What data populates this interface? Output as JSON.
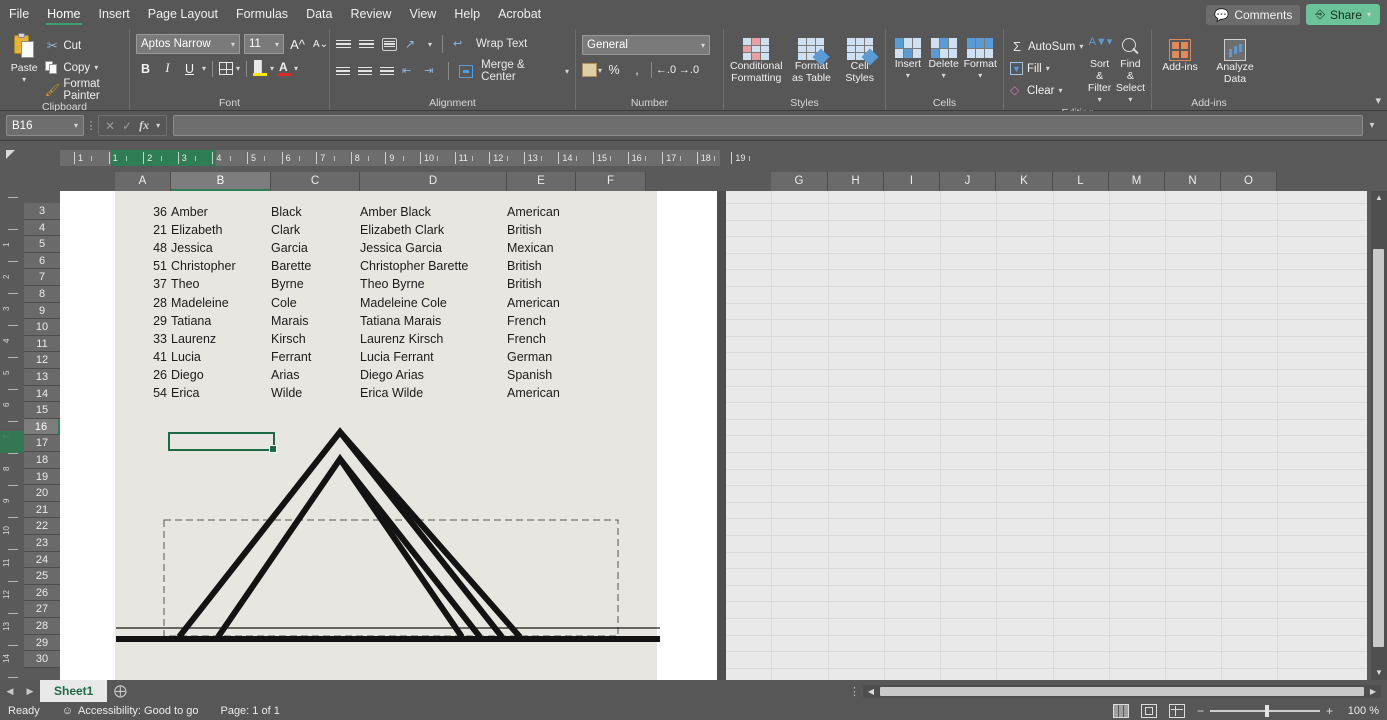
{
  "app": {
    "menu_tabs": [
      "File",
      "Home",
      "Insert",
      "Page Layout",
      "Formulas",
      "Data",
      "Review",
      "View",
      "Help",
      "Acrobat"
    ],
    "active_tab": "Home",
    "comments_label": "Comments",
    "share_label": "Share",
    "accent_green": "#2f7d55",
    "share_bg": "#6cc39a"
  },
  "ribbon": {
    "clipboard": {
      "title": "Clipboard",
      "paste": "Paste",
      "cut": "Cut",
      "copy": "Copy",
      "format_painter": "Format Painter"
    },
    "font": {
      "title": "Font",
      "font_name": "Aptos Narrow",
      "font_size": "11",
      "bold": "B",
      "italic": "I",
      "underline": "U"
    },
    "alignment": {
      "title": "Alignment",
      "wrap_text": "Wrap Text",
      "merge_center": "Merge & Center"
    },
    "number": {
      "title": "Number",
      "format": "General",
      "percent": "%",
      "comma": ","
    },
    "styles": {
      "title": "Styles",
      "conditional_formatting": "Conditional Formatting",
      "format_as_table": "Format as Table",
      "cell_styles": "Cell Styles"
    },
    "cells": {
      "title": "Cells",
      "insert": "Insert",
      "delete": "Delete",
      "format": "Format"
    },
    "editing": {
      "title": "Editing",
      "autosum": "AutoSum",
      "fill": "Fill",
      "clear": "Clear",
      "sort_filter": "Sort & Filter",
      "find_select": "Find & Select"
    },
    "addins": {
      "title": "Add-ins",
      "addins": "Add-ins",
      "analyze_data": "Analyze Data"
    }
  },
  "formula_bar": {
    "name_box": "B16",
    "formula_value": "",
    "cancel_icon": "cancel-icon",
    "enter_icon": "enter-icon",
    "fx_label": "fx"
  },
  "ruler": {
    "unit_labels": [
      "1",
      "1",
      "2",
      "3",
      "4",
      "5",
      "6",
      "7",
      "8",
      "9",
      "10",
      "11",
      "12",
      "13",
      "14",
      "15",
      "16",
      "17",
      "18",
      "19"
    ],
    "highlight_from": "2",
    "highlight_to": "5"
  },
  "grid": {
    "column_headers": [
      "A",
      "B",
      "C",
      "D",
      "E",
      "F",
      "G",
      "H",
      "I",
      "J",
      "K",
      "L",
      "M",
      "N",
      "O"
    ],
    "selected_column": "B",
    "row_headers": [
      "3",
      "4",
      "5",
      "6",
      "7",
      "8",
      "9",
      "10",
      "11",
      "12",
      "13",
      "14",
      "15",
      "16",
      "17",
      "18",
      "19",
      "20",
      "21",
      "22",
      "23",
      "24",
      "25",
      "26",
      "27",
      "28",
      "29",
      "30"
    ],
    "selected_row": "16",
    "selected_cell": "B16"
  },
  "table": {
    "columns": [
      "A",
      "B",
      "C",
      "D",
      "E"
    ],
    "rows": [
      {
        "row": "3",
        "a": "36",
        "b": "Amber",
        "c": "Black",
        "d": "Amber  Black",
        "e": "American"
      },
      {
        "row": "4",
        "a": "21",
        "b": "Elizabeth",
        "c": "Clark",
        "d": "Elizabeth  Clark",
        "e": "British"
      },
      {
        "row": "5",
        "a": "48",
        "b": "Jessica",
        "c": "Garcia",
        "d": "Jessica Garcia",
        "e": "Mexican"
      },
      {
        "row": "6",
        "a": "51",
        "b": "Christopher",
        "c": "Barette",
        "d": "Christopher Barette",
        "e": "British"
      },
      {
        "row": "7",
        "a": "37",
        "b": "Theo",
        "c": "Byrne",
        "d": "Theo Byrne",
        "e": "British"
      },
      {
        "row": "8",
        "a": "28",
        "b": "Madeleine",
        "c": "Cole",
        "d": "Madeleine Cole",
        "e": "American"
      },
      {
        "row": "9",
        "a": "29",
        "b": "Tatiana",
        "c": "Marais",
        "d": "Tatiana Marais",
        "e": "French"
      },
      {
        "row": "10",
        "a": "33",
        "b": "Laurenz",
        "c": "Kirsch",
        "d": "Laurenz Kirsch",
        "e": "French"
      },
      {
        "row": "11",
        "a": "41",
        "b": "Lucia",
        "c": "Ferrant",
        "d": "Lucia Ferrant",
        "e": "German"
      },
      {
        "row": "12",
        "a": "26",
        "b": "Diego",
        "c": "Arias",
        "d": "Diego Arias",
        "e": "Spanish"
      },
      {
        "row": "13",
        "a": "54",
        "b": "Erica",
        "c": "Wilde",
        "d": "Erica Wilde",
        "e": "American"
      }
    ]
  },
  "drawing": {
    "description": "two overlapping black outlined triangles with dashed rectangle and horizontal baselines",
    "stroke_color": "#131313",
    "dash_color": "#5a5a5a"
  },
  "sheet_tabs": {
    "tabs": [
      "Sheet1"
    ],
    "active": "Sheet1",
    "add_label": "+"
  },
  "status_bar": {
    "ready": "Ready",
    "accessibility": "Accessibility: Good to go",
    "page": "Page: 1 of 1",
    "zoom": "100 %",
    "views": [
      "normal-view",
      "page-layout-view",
      "page-break-view"
    ]
  }
}
